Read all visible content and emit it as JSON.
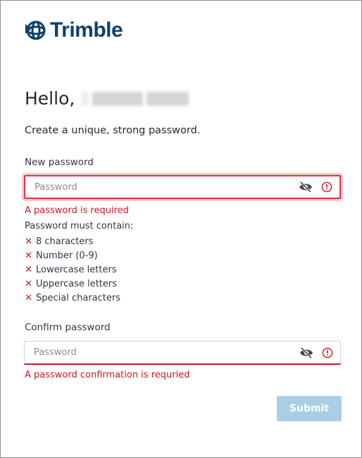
{
  "brand": {
    "name": "Trimble",
    "color": "#0e416c"
  },
  "greeting": {
    "text": "Hello,"
  },
  "subtitle": "Create a unique, strong password.",
  "new_password": {
    "label": "New password",
    "placeholder": "Password",
    "error": "A password is required",
    "eye_icon": "eye-slash-icon",
    "alert_icon": "alert-circle-icon"
  },
  "requirements": {
    "title": "Password must contain:",
    "items": [
      {
        "icon": "x-icon",
        "label": "8 characters"
      },
      {
        "icon": "x-icon",
        "label": "Number (0-9)"
      },
      {
        "icon": "x-icon",
        "label": "Lowercase letters"
      },
      {
        "icon": "x-icon",
        "label": "Uppercase letters"
      },
      {
        "icon": "x-icon",
        "label": "Special characters"
      }
    ]
  },
  "confirm_password": {
    "label": "Confirm password",
    "placeholder": "Password",
    "error": "A password confirmation is requried"
  },
  "submit": {
    "label": "Submit"
  },
  "colors": {
    "error": "#c81922",
    "submit_disabled": "#a9cfe6"
  }
}
